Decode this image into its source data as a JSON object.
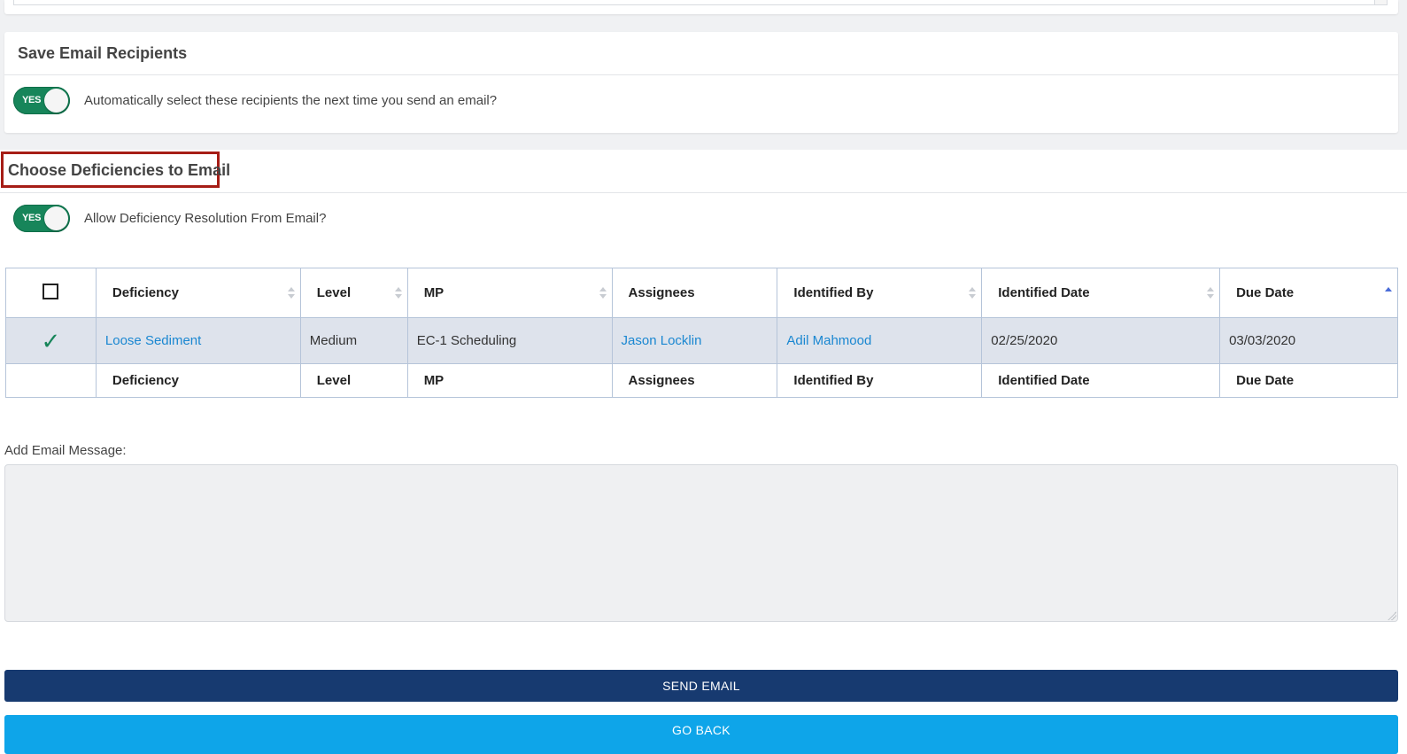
{
  "save_recipients": {
    "title": "Save Email Recipients",
    "toggle_text": "YES",
    "toggle_on": true,
    "label": "Automatically select these recipients the next time you send an email?"
  },
  "deficiencies": {
    "title": "Choose Deficiencies to Email",
    "toggle_text": "YES",
    "toggle_on": true,
    "toggle_label": "Allow Deficiency Resolution From Email?",
    "columns": [
      "Deficiency",
      "Level",
      "MP",
      "Assignees",
      "Identified By",
      "Identified Date",
      "Due Date"
    ],
    "rows": [
      {
        "selected": true,
        "check_glyph": "✓",
        "deficiency": "Loose Sediment",
        "level": "Medium",
        "mp": "EC-1 Scheduling",
        "assignees": "Jason Locklin",
        "identified_by": "Adil Mahmood",
        "identified_date": "02/25/2020",
        "due_date": "03/03/2020"
      }
    ],
    "sorted_column": "Due Date",
    "sort_direction": "asc"
  },
  "message": {
    "label": "Add Email Message:",
    "value": ""
  },
  "buttons": {
    "send": "SEND EMAIL",
    "back": "GO BACK"
  },
  "colors": {
    "toggle_on": "#17855a",
    "send_button": "#173a70",
    "back_button": "#0ea5e9",
    "link": "#1a87d1",
    "highlight_border": "#a61d16",
    "selected_row": "#dee3ec"
  }
}
